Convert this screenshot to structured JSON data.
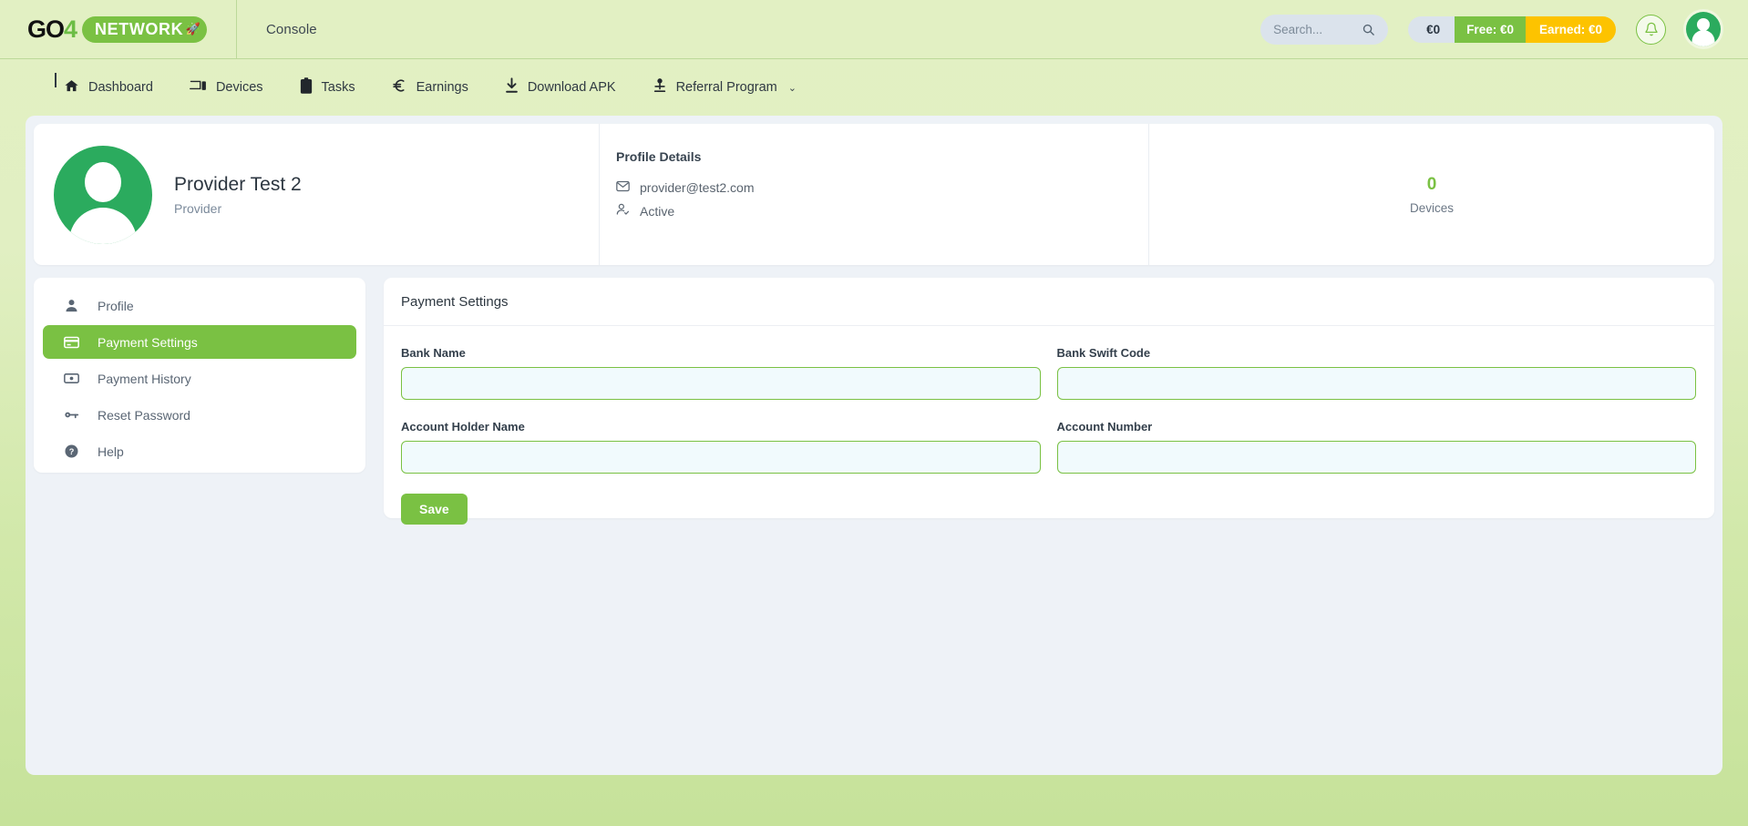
{
  "header": {
    "logo_primary": "GO",
    "logo_four": "4",
    "logo_pill": "NETWORK",
    "logo_rocket_icon": "rocket-icon",
    "console_label": "Console",
    "search": {
      "placeholder": "Search...",
      "value": ""
    },
    "balance": {
      "total": "€0",
      "free": "Free: €0",
      "earned": "Earned: €0"
    },
    "notifications_icon": "bell-icon",
    "avatar_icon": "user-avatar"
  },
  "nav": {
    "items": [
      {
        "label": "Dashboard",
        "icon": "home-icon",
        "caret": ""
      },
      {
        "label": "Devices",
        "icon": "devices-icon",
        "caret": ""
      },
      {
        "label": "Tasks",
        "icon": "clipboard-icon",
        "caret": ""
      },
      {
        "label": "Earnings",
        "icon": "euro-icon",
        "caret": ""
      },
      {
        "label": "Download APK",
        "icon": "download-icon",
        "caret": ""
      },
      {
        "label": "Referral Program",
        "icon": "person-share-icon",
        "caret": "⌄"
      }
    ]
  },
  "profile": {
    "name": "Provider Test 2",
    "role": "Provider",
    "details_title": "Profile Details",
    "email": "provider@test2.com",
    "email_icon": "mail-icon",
    "status": "Active",
    "status_icon": "user-check-icon",
    "stat_value": "0",
    "stat_label": "Devices"
  },
  "sidebar": {
    "items": [
      {
        "label": "Profile",
        "icon": "person-icon",
        "active": false
      },
      {
        "label": "Payment Settings",
        "icon": "credit-card-icon",
        "active": true
      },
      {
        "label": "Payment History",
        "icon": "banknote-icon",
        "active": false
      },
      {
        "label": "Reset Password",
        "icon": "key-icon",
        "active": false
      },
      {
        "label": "Help",
        "icon": "help-circle-icon",
        "active": false
      }
    ]
  },
  "panel": {
    "title": "Payment Settings",
    "fields": [
      {
        "label": "Bank Name",
        "value": "",
        "placeholder": "",
        "focused": true
      },
      {
        "label": "Bank Swift Code",
        "value": "",
        "placeholder": "",
        "focused": false
      },
      {
        "label": "Account Holder Name",
        "value": "",
        "placeholder": "",
        "focused": true
      },
      {
        "label": "Account Number",
        "value": "",
        "placeholder": "",
        "focused": false
      }
    ],
    "save_label": "Save"
  },
  "colors": {
    "brand_green": "#7ac143",
    "avatar_green": "#2bab5e",
    "amber": "#fdc300",
    "chip_grey": "#dbe3ec",
    "panel_bg": "#eef2f7",
    "input_fill": "#f1fafd"
  }
}
